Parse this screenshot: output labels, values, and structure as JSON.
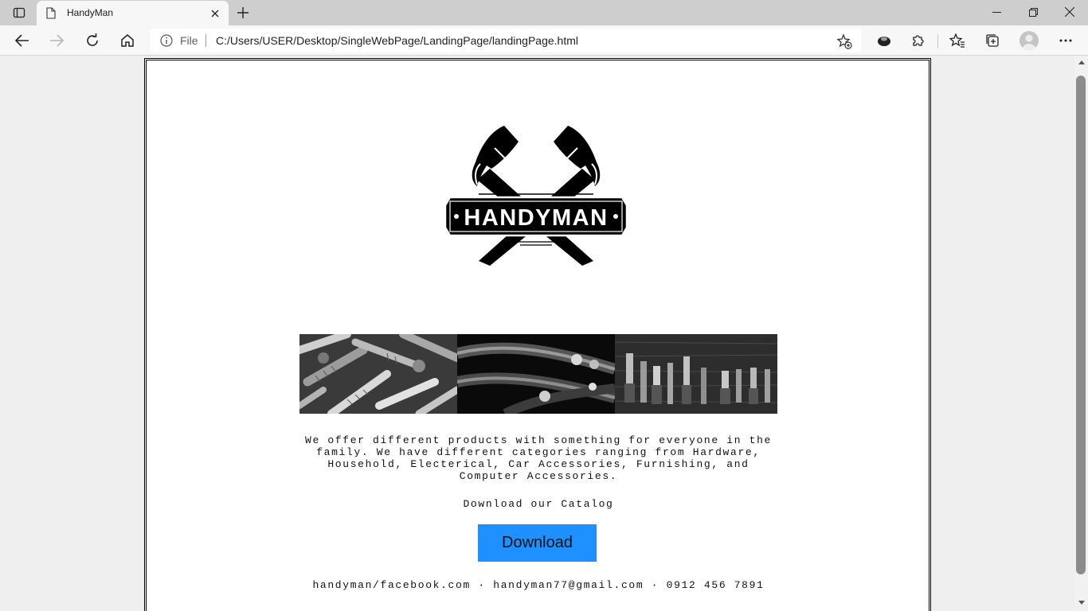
{
  "browser": {
    "tab": {
      "title": "HandyMan"
    },
    "address_bar": {
      "scheme_label": "File",
      "url": "C:/Users/USER/Desktop/SingleWebPage/LandingPage/landingPage.html"
    }
  },
  "page": {
    "logo_text": "HANDYMAN",
    "description": "We offer different products with something for everyone in the family. We have different categories ranging from Hardware, Household, Electerical, Car Accessories, Furnishing, and Computer Accessories.",
    "catalog_label": "Download our Catalog",
    "download_label": "Download",
    "footer": {
      "facebook": "handyman/facebook.com",
      "email": "handyman77@gmail.com",
      "phone": "0912 456 7891",
      "separator": "·"
    }
  },
  "colors": {
    "download_button": "#1e90ff",
    "tab_strip": "#cecece",
    "toolbar": "#f7f7f7"
  }
}
